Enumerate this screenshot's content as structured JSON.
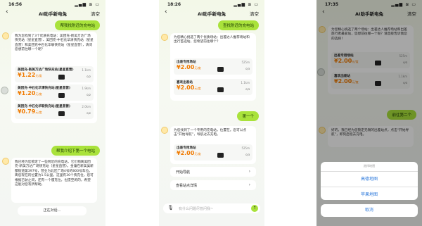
{
  "screens": [
    {
      "time": "16:56",
      "title": "AI助手新电兔",
      "clear": "清空",
      "user_top": "帮我找附近的充电站",
      "ai_intro": "我为您找到了3个优质充电站：美团充-新美万达广场快充站（星星直营）、美团充-中石化华清快充站（星星直营）和美团充中石化华联快充站（星星直营），请问您想前往哪一个呢？",
      "stations": [
        {
          "name": "美团充-新美万达广场快充站(星星直营)",
          "dist": "1.1km",
          "price": "1.22",
          "unit": "元/度",
          "count": "0/2"
        },
        {
          "name": "美团充-中石化华清快充站(星星直营)",
          "dist": "1.9km",
          "price": "1.20",
          "unit": "元/度",
          "count": "0/2"
        },
        {
          "name": "美团充-中石化华联快充站(星星直营)",
          "dist": "2.0km",
          "price": "0.79",
          "unit": "元/度",
          "count": "0/2"
        }
      ],
      "user_msg": "帮我介绍下第一个电站",
      "ai_reply": "我已经为您锁定了一些附近的充电站，它们稍离美团充-新美万达广场快充站（星星直营）。金藩在新美吴新都街道第397号，营业为北区广场4号的800号车位。离您现在的位置为1.5公里。这里有30个快充位，您可根据已驶之间，还有一个慢充位，也提空闲的，希望这能对您有所帮助。",
      "thinking": "正在对话..."
    },
    {
      "time": "18:26",
      "title": "AI助手新电兔",
      "clear": "清空",
      "user_top": "查找附近的充电站",
      "ai_intro": "为您精心挑选了两个优质场站：出差达人推荐场站和出行首选站，您希望前往哪个？",
      "stations": [
        {
          "name": "出差专用场站",
          "dist": "525m",
          "price": "2.00",
          "unit": "元/度",
          "count": "0/3"
        },
        {
          "name": "喜欢出差站",
          "dist": "1.1km",
          "price": "2.00",
          "unit": "元/度",
          "count": "0/3"
        }
      ],
      "user_msg": "第一个",
      "ai_reply": "为您找到了一个专用的充电站，位置在。您可以点击“开始导航”，导航过去充电。",
      "station_single": {
        "name": "出差专用场站",
        "dist": "525m",
        "price": "2.00",
        "unit": "元/度",
        "count": "0/3"
      },
      "actions": [
        "开始导航",
        "查看站点详情"
      ],
      "input_placeholder": "有什么问题尽管问我~"
    },
    {
      "time": "17:35",
      "title": "AI助手新电兔",
      "clear": "清空",
      "ai_intro": "为您精心挑选了两个场站：出差达人推荐场站和出差旅行者最爱站，您想前往哪一个呢？请直接告诉我您的选择！",
      "stations": [
        {
          "name": "出差专用场站",
          "dist": "525m",
          "price": "2.00",
          "unit": "元/度",
          "count": "0/3"
        },
        {
          "name": "喜欢出差站",
          "dist": "1.1km",
          "price": "2.00",
          "unit": "元/度",
          "count": "0/3"
        }
      ],
      "user_msg": "前往第二个",
      "ai_reply": "好的，我已经为您锁定无锡的出差站点，点击“开始导航”，即刻启程去充电。",
      "sheet_title": "选择地图",
      "sheet_options": [
        "高德地图",
        "苹果地图"
      ],
      "cancel": "取消"
    }
  ],
  "colors": {
    "accent": "#a9e23b",
    "price": "#f07a00",
    "link": "#2f7bdc"
  }
}
